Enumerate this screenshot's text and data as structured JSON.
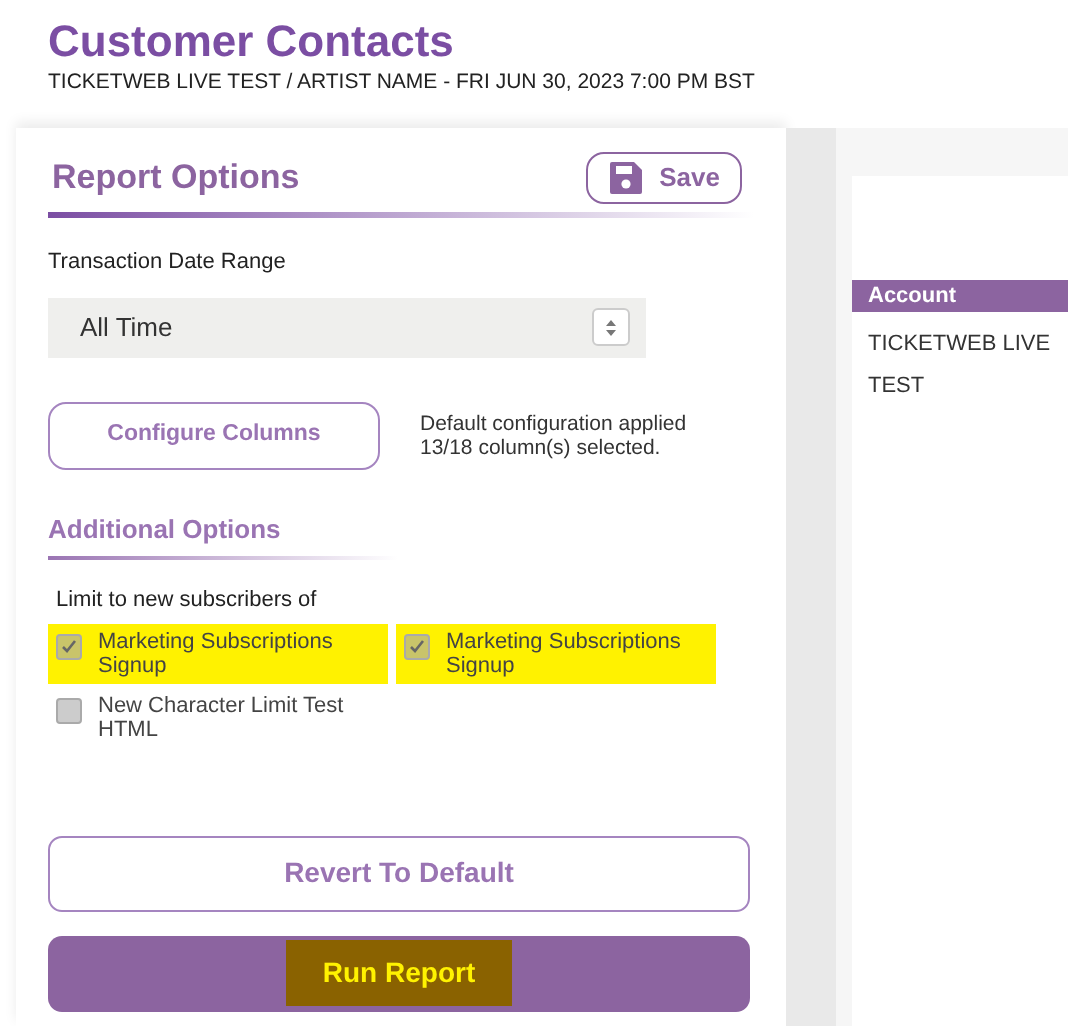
{
  "header": {
    "title": "Customer Contacts",
    "subtitle": "TICKETWEB LIVE TEST / ARTIST NAME - FRI JUN 30, 2023 7:00 PM BST"
  },
  "report_options": {
    "title": "Report Options",
    "save_button": "Save",
    "date_range": {
      "label": "Transaction Date Range",
      "value": "All Time"
    },
    "configure_button": "Configure Columns",
    "configure_note": [
      "Default configuration applied",
      "13/18 column(s) selected."
    ],
    "additional_title": "Additional Options",
    "limit_label": "Limit to new subscribers of",
    "options": [
      {
        "label": "Marketing Subscriptions Signup",
        "checked": true,
        "highlighted": true
      },
      {
        "label": "Marketing Subscriptions Signup",
        "checked": true,
        "highlighted": true
      },
      {
        "label": "New Character Limit Test HTML",
        "checked": false,
        "highlighted": false
      }
    ],
    "revert_button": "Revert To Default",
    "run_button": {
      "label": "Run Report",
      "highlighted": true
    }
  },
  "table": {
    "columns": [
      "Account"
    ],
    "rows": [
      [
        "TICKETWEB LIVE"
      ],
      [
        "TEST"
      ]
    ]
  }
}
